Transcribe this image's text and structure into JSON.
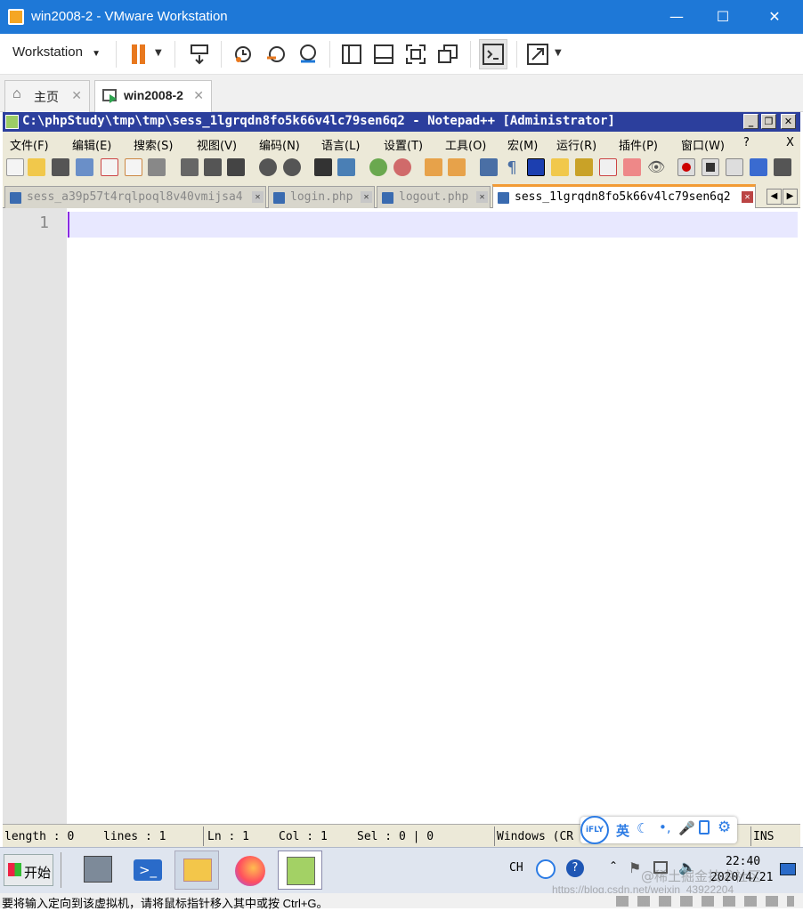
{
  "vmware": {
    "title": "win2008-2 - VMware Workstation",
    "menu_label": "Workstation",
    "tabs": [
      {
        "label": "主页"
      },
      {
        "label": "win2008-2"
      }
    ]
  },
  "npp": {
    "title": "C:\\phpStudy\\tmp\\tmp\\sess_1lgrqdn8fo5k66v4lc79sen6q2 - Notepad++ [Administrator]",
    "menu": [
      "文件(F)",
      "编辑(E)",
      "搜索(S)",
      "视图(V)",
      "编码(N)",
      "语言(L)",
      "设置(T)",
      "工具(O)",
      "宏(M)",
      "运行(R)",
      "插件(P)",
      "窗口(W)",
      "?"
    ],
    "menu_close": "X",
    "tabs": [
      {
        "label": "sess_a39p57t4rqlpoql8v40vmijsa4"
      },
      {
        "label": "login.php"
      },
      {
        "label": "logout.php"
      },
      {
        "label": "sess_1lgrqdn8fo5k66v4lc79sen6q2"
      }
    ],
    "line_number": "1",
    "status": {
      "length": "length : 0",
      "lines": "lines : 1",
      "ln": "Ln : 1",
      "col": "Col : 1",
      "sel": "Sel : 0 | 0",
      "eol": "Windows (CR LF)",
      "ins": "INS"
    }
  },
  "ime": {
    "logo": "iFLY",
    "lang": "英"
  },
  "taskbar": {
    "start": "开始",
    "lang": "CH",
    "time": "22:40",
    "date": "2020/4/21"
  },
  "hint": "要将输入定向到该虚拟机，请将鼠标指针移入其中或按 Ctrl+G。",
  "watermark": "https://blog.csdn.net/weixin_43922204",
  "watermark2": "@稀土掘金技术社区"
}
